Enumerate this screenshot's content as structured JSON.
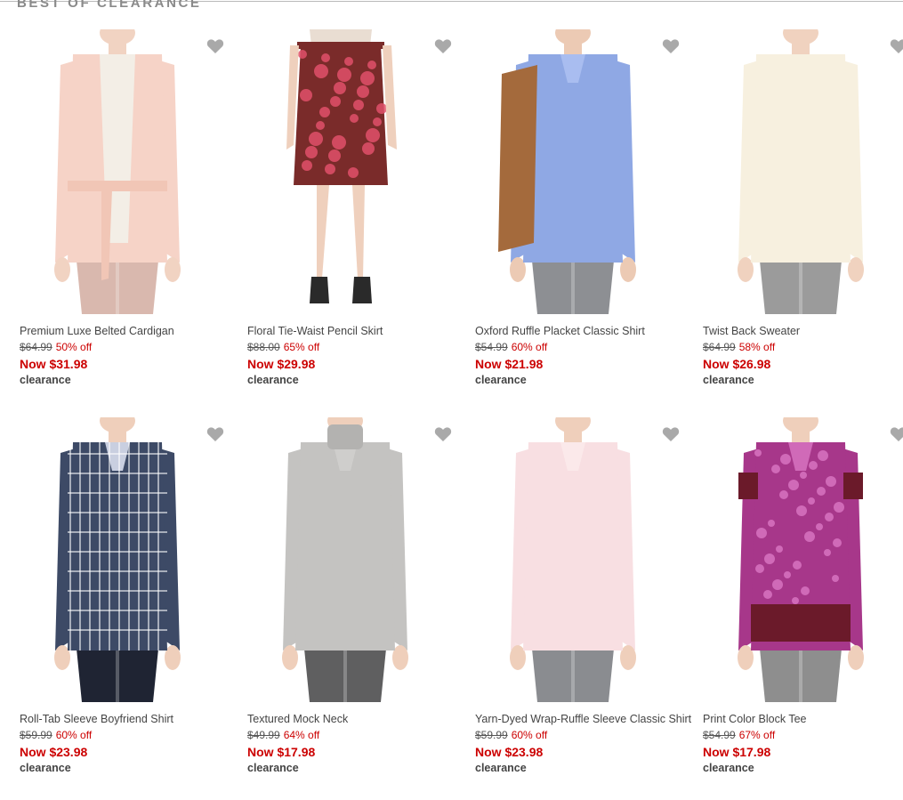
{
  "section": {
    "title": "BEST OF CLEARANCE"
  },
  "products": [
    {
      "name": "Premium Luxe Belted Cardigan",
      "was": "$64.99",
      "off": "50% off",
      "now": "Now $31.98",
      "badge": "clearance",
      "colors": {
        "top": "#f6d3c7",
        "inner": "#f3eee6",
        "bottom": "#d9b8ae",
        "skin": "#f1d3c2",
        "accent": "#f1c6b6"
      }
    },
    {
      "name": "Floral Tie-Waist Pencil Skirt",
      "was": "$88.00",
      "off": "65% off",
      "now": "Now $29.98",
      "badge": "clearance",
      "colors": {
        "top": "#e9ddd2",
        "inner": "#e9ddd2",
        "bottom": "#7a2b2a",
        "skin": "#efd0bd",
        "accent": "#e0506a"
      }
    },
    {
      "name": "Oxford Ruffle Placket Classic Shirt",
      "was": "$54.99",
      "off": "60% off",
      "now": "Now $21.98",
      "badge": "clearance",
      "colors": {
        "top": "#8fa8e4",
        "inner": "#a9bdf0",
        "bottom": "#8d8f93",
        "skin": "#eccab4",
        "accent": "#a46a3c"
      }
    },
    {
      "name": "Twist Back Sweater",
      "was": "$64.99",
      "off": "58% off",
      "now": "Now $26.98",
      "badge": "clearance",
      "colors": {
        "top": "#f7f0df",
        "inner": "#f7f0df",
        "bottom": "#9b9b9b",
        "skin": "#f0d2bf",
        "accent": "#efe5cf"
      }
    },
    {
      "name": "Roll-Tab Sleeve Boyfriend Shirt",
      "was": "$59.99",
      "off": "60% off",
      "now": "Now $23.98",
      "badge": "clearance",
      "colors": {
        "top": "#3d4a66",
        "inner": "#c9cfe0",
        "bottom": "#1f2433",
        "skin": "#efcfbb",
        "accent": "#ffffff"
      }
    },
    {
      "name": "Textured Mock Neck",
      "was": "$49.99",
      "off": "64% off",
      "now": "Now $17.98",
      "badge": "clearance",
      "colors": {
        "top": "#c4c3c1",
        "inner": "#cfcecc",
        "bottom": "#5f5f60",
        "skin": "#efcfbb",
        "accent": "#b3b2b0"
      }
    },
    {
      "name": "Yarn-Dyed Wrap-Ruffle Sleeve Classic Shirt",
      "was": "$59.99",
      "off": "60% off",
      "now": "Now $23.98",
      "badge": "clearance",
      "colors": {
        "top": "#f8dfe2",
        "inner": "#fbe9ea",
        "bottom": "#8a8c90",
        "skin": "#efcfbb",
        "accent": "#f4d0d5"
      }
    },
    {
      "name": "Print Color Block Tee",
      "was": "$54.99",
      "off": "67% off",
      "now": "Now $17.98",
      "badge": "clearance",
      "colors": {
        "top": "#a7378a",
        "inner": "#d06ab8",
        "bottom": "#8e8e8e",
        "skin": "#efcfbb",
        "accent": "#6b1a2a"
      }
    }
  ],
  "colors": {
    "sale": "#cc0000",
    "heart": "#a9a9a9",
    "text": "#444444"
  },
  "icons": {
    "favorite": "heart-icon"
  }
}
